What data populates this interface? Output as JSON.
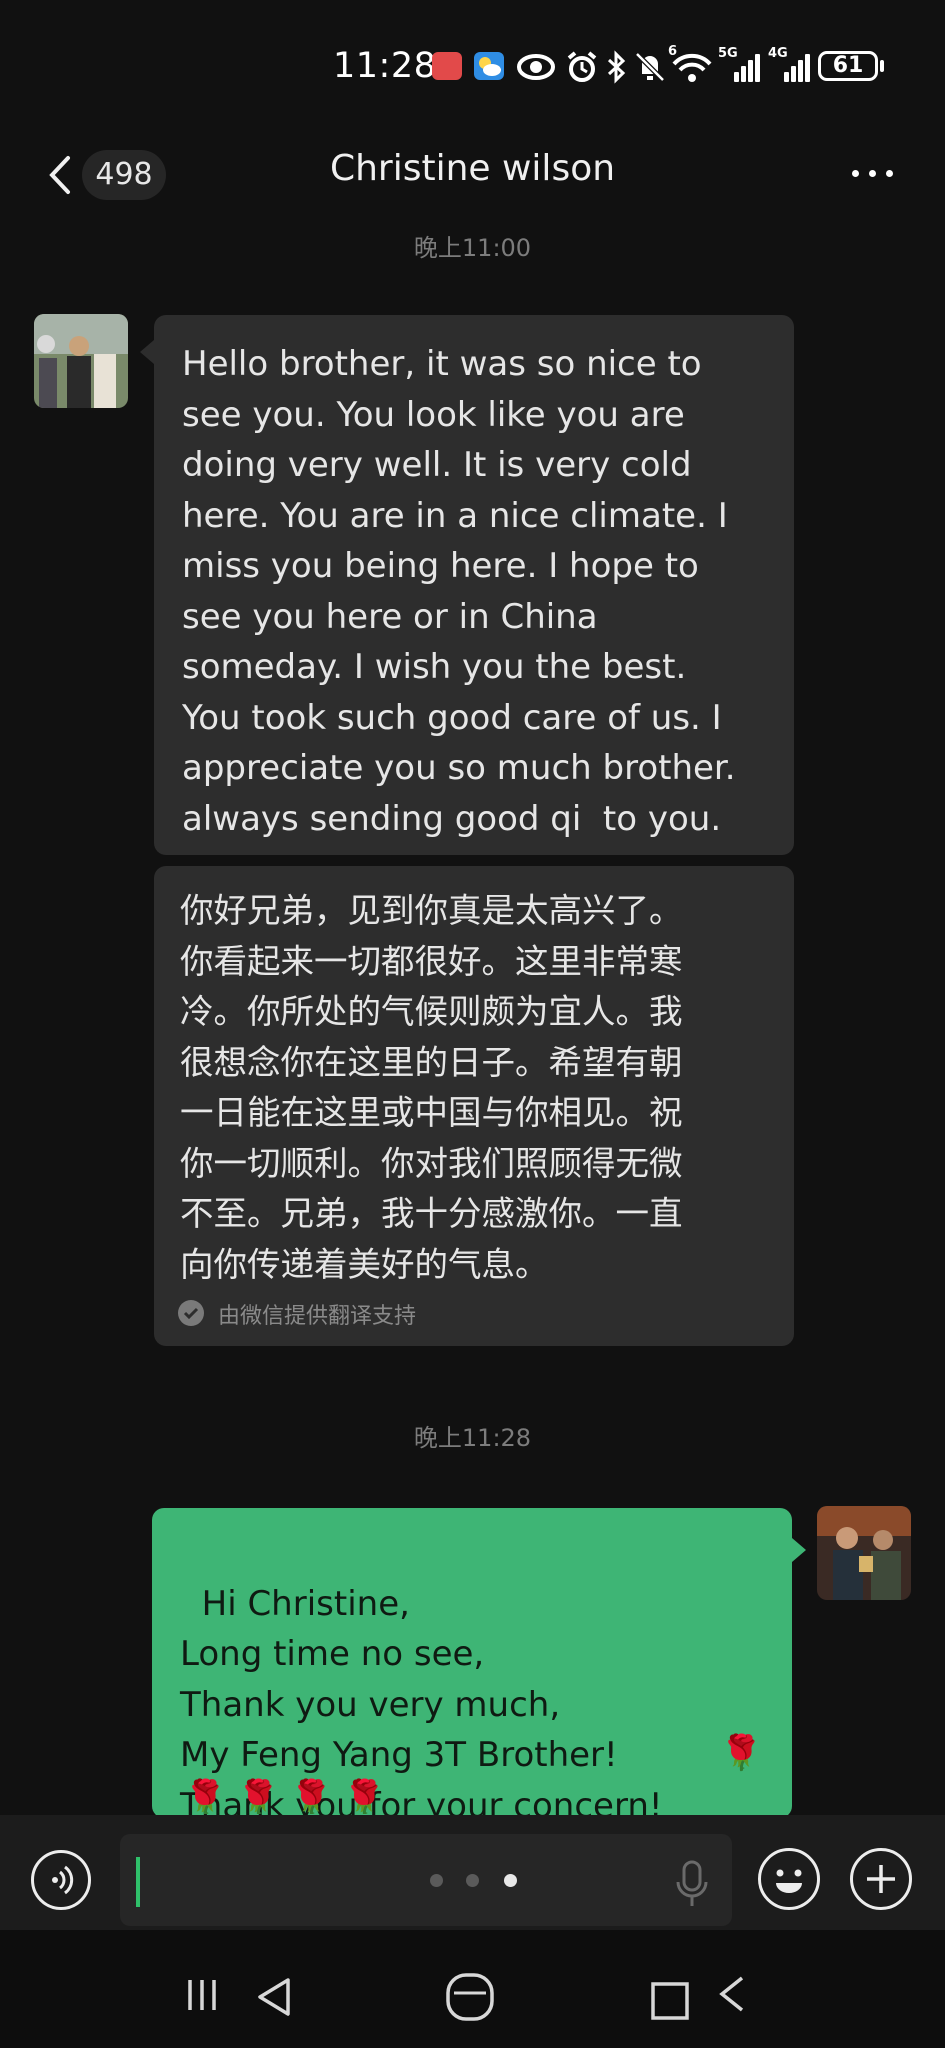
{
  "status_bar": {
    "time": "11:28",
    "icons": [
      "huawei-app-icon",
      "weather-icon",
      "eye-icon",
      "alarm-icon",
      "bluetooth-icon",
      "mute-icon",
      "wifi-icon",
      "5g-signal-icon",
      "4g-signal-icon"
    ],
    "sig1_label": "5G",
    "sig2_label": "4G",
    "wifi_label": "6",
    "battery": "61"
  },
  "header": {
    "unread_count": "498",
    "title": "Christine wilson"
  },
  "timestamps": [
    "晚上11:00",
    "晚上11:28"
  ],
  "messages": {
    "incoming_text": "Hello brother, it was so nice to\nsee you. You look like you are\ndoing very well. It is very cold\nhere. You are in a nice climate. I\nmiss you being here. I hope to\nsee you here or in China\nsomeday. I wish you the best.\nYou took such good care of us. I\nappreciate you so much brother.\nalways sending good qi  to you.",
    "translation_text": "你好兄弟，见到你真是太高兴了。\n你看起来一切都很好。这里非常寒\n冷。你所处的气候则颇为宜人。我\n很想念你在这里的日子。希望有朝\n一日能在这里或中国与你相见。祝\n你一切顺利。你对我们照顾得无微\n不至。兄弟，我十分感激你。一直\n向你传递着美好的气息。",
    "translation_note": "由微信提供翻译支持",
    "outgoing_text": "Hi Christine,\nLong time no see,\nThank you very much,\nMy Feng Yang 3T Brother!\nThank you for your concern!",
    "rose_emoji": "🌹",
    "rose_row": "🌹 🌹 🌹 🌹"
  },
  "colors": {
    "background": "#111111",
    "incoming_bubble": "#2d2d2d",
    "outgoing_bubble": "#3eb575",
    "caret": "#2fc06a"
  }
}
